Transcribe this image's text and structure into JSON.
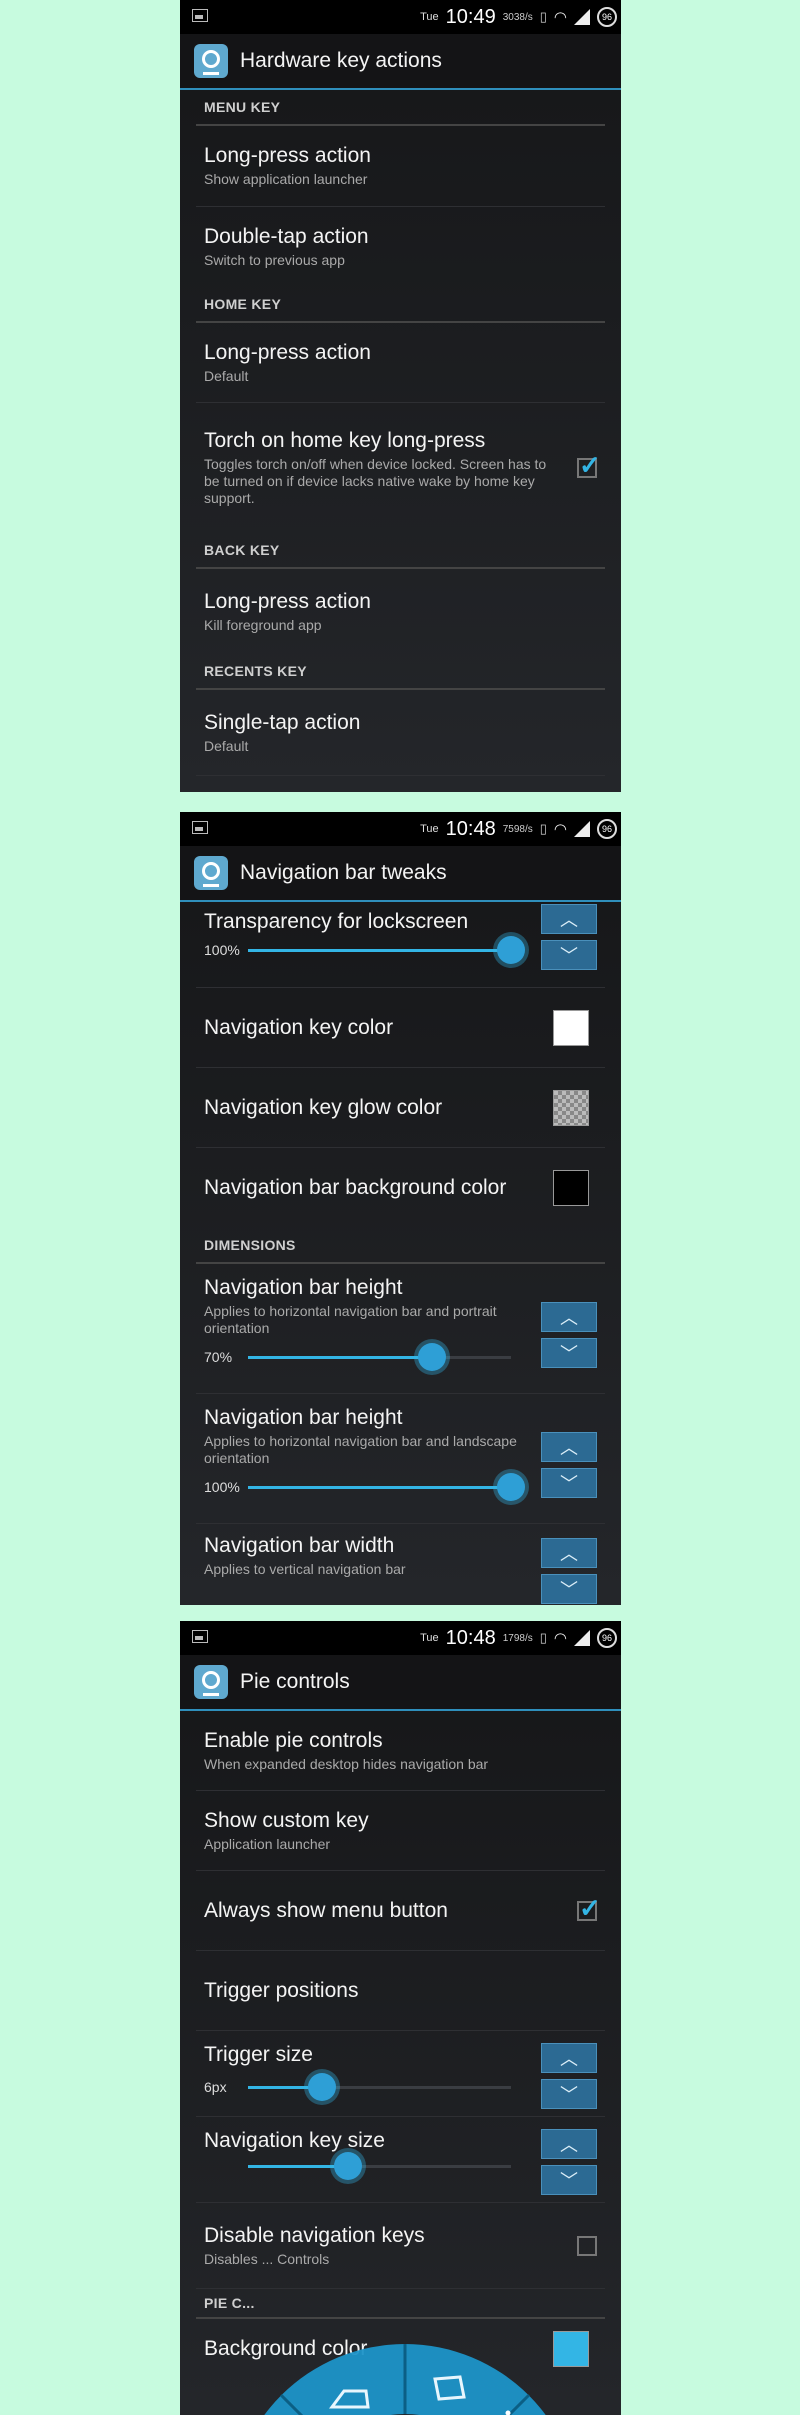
{
  "screens": [
    {
      "status": {
        "day": "Tue",
        "time": "10:49",
        "speed": "3038/s",
        "battery": "96"
      },
      "title": "Hardware key actions",
      "sections": [
        {
          "header": "MENU KEY",
          "items": [
            {
              "title": "Long-press action",
              "summary": "Show application launcher"
            },
            {
              "title": "Double-tap action",
              "summary": "Switch to previous app"
            }
          ]
        },
        {
          "header": "HOME KEY",
          "items": [
            {
              "title": "Long-press action",
              "summary": "Default"
            },
            {
              "title": "Torch on home key long-press",
              "summary": "Toggles torch on/off when device locked. Screen has to be turned on if device lacks native wake by home key support.",
              "checked": true
            }
          ]
        },
        {
          "header": "BACK KEY",
          "items": [
            {
              "title": "Long-press action",
              "summary": "Kill foreground app"
            }
          ]
        },
        {
          "header": "RECENTS KEY",
          "items": [
            {
              "title": "Single-tap action",
              "summary": "Default"
            }
          ]
        }
      ]
    },
    {
      "status": {
        "day": "Tue",
        "time": "10:48",
        "speed": "7598/s",
        "battery": "96"
      },
      "title": "Navigation bar tweaks",
      "items": {
        "transparency": {
          "title": "Transparency for lockscreen",
          "value": "100%",
          "fraction": 1.0
        },
        "key_color": {
          "title": "Navigation key color",
          "swatch": "#ffffff"
        },
        "glow_color": {
          "title": "Navigation key glow color",
          "swatch": "transparent"
        },
        "bg_color": {
          "title": "Navigation bar background color",
          "swatch": "#000000"
        }
      },
      "dimensions_header": "DIMENSIONS",
      "dims": [
        {
          "title": "Navigation bar height",
          "summary": "Applies to horizontal navigation bar and portrait orientation",
          "value": "70%",
          "fraction": 0.7
        },
        {
          "title": "Navigation bar height",
          "summary": "Applies to horizontal navigation bar and landscape orientation",
          "value": "100%",
          "fraction": 1.0
        },
        {
          "title": "Navigation bar width",
          "summary": "Applies to vertical navigation bar"
        }
      ]
    },
    {
      "status": {
        "day": "Tue",
        "time": "10:48",
        "speed": "1798/s",
        "battery": "96"
      },
      "title": "Pie controls",
      "items": {
        "enable": {
          "title": "Enable pie controls",
          "summary": "When expanded desktop hides navigation bar"
        },
        "custom_key": {
          "title": "Show custom key",
          "summary": "Application launcher"
        },
        "menu_button": {
          "title": "Always show menu button",
          "checked": true
        },
        "trigger_positions": {
          "title": "Trigger positions"
        },
        "trigger_size": {
          "title": "Trigger size",
          "value": "6px",
          "fraction": 0.28
        },
        "key_size": {
          "title": "Navigation key size",
          "fraction": 0.38
        },
        "disable_keys": {
          "title": "Disable navigation keys",
          "summary": "Disables ... Controls"
        },
        "pie_header": "PIE C...",
        "bg_color": {
          "title": "Background color",
          "swatch": "#33b5e5"
        }
      }
    }
  ],
  "colors": {
    "accent": "#33b5e5",
    "pie": "#1e94c8"
  }
}
